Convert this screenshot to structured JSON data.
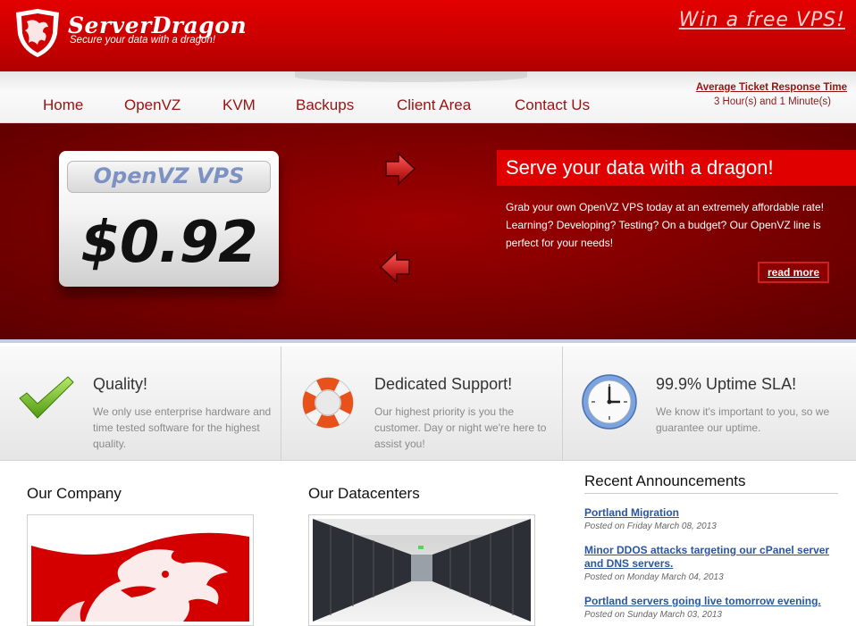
{
  "brand": {
    "name": "ServerDragon",
    "tagline": "Secure your data with a dragon!",
    "promo": "Win a free VPS!"
  },
  "nav": {
    "items": [
      "Home",
      "OpenVZ",
      "KVM",
      "Backups",
      "Client Area",
      "Contact Us"
    ]
  },
  "ticket": {
    "title": "Average Ticket Response Time",
    "time": "3 Hour(s) and 1 Minute(s)"
  },
  "hero": {
    "plan": "OpenVZ VPS",
    "price": "$0.92",
    "title": "Serve your data with a dragon!",
    "description": "Grab your own OpenVZ VPS today at an extremely affordable rate! Learning? Developing? Testing? On a budget? Our OpenVZ line is perfect for your needs!",
    "read_more": "read more"
  },
  "features": [
    {
      "title": "Quality!",
      "text": "We only use enterprise hardware and time tested software for the highest quality.",
      "icon": "checkmark-icon"
    },
    {
      "title": "Dedicated Support!",
      "text": "Our highest priority is you the customer. Day or night we're here to assist you!",
      "icon": "lifebuoy-icon"
    },
    {
      "title": "99.9% Uptime SLA!",
      "text": "We know it's important to you, so we guarantee our uptime.",
      "icon": "clock-icon"
    }
  ],
  "sections": {
    "company": "Our Company",
    "datacenters": "Our Datacenters"
  },
  "announcements": {
    "title": "Recent Announcements",
    "items": [
      {
        "title": "Portland Migration",
        "date": "Posted on Friday March 08, 2013"
      },
      {
        "title": "Minor DDOS attacks targeting our cPanel server and DNS servers.",
        "date": "Posted on Monday March 04, 2013"
      },
      {
        "title": "Portland servers going live tomorrow evening.",
        "date": "Posted on Sunday March 03, 2013"
      }
    ]
  },
  "colors": {
    "brand_red": "#e30000",
    "dark_red": "#7a0000",
    "nav_text": "#9a1212",
    "link_blue": "#2a56a0"
  }
}
